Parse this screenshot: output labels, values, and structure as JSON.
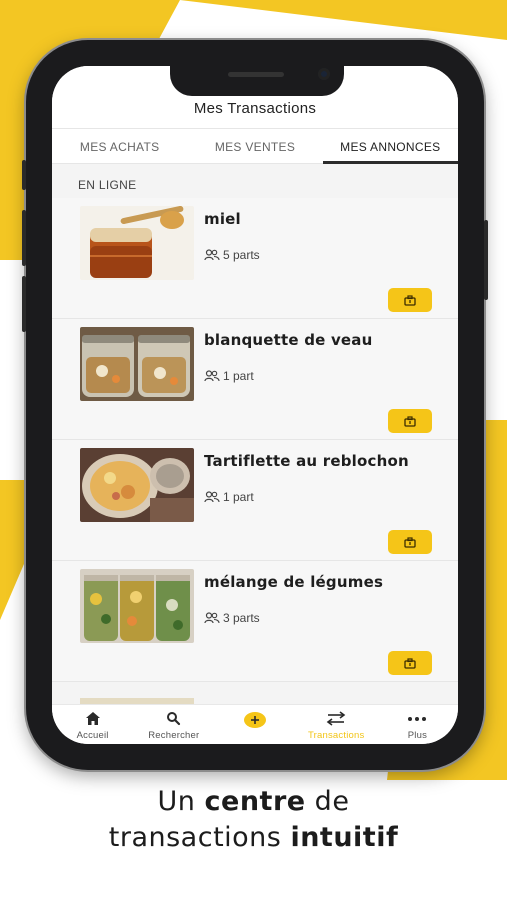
{
  "screen": {
    "title": "Mes Transactions",
    "tabs": [
      {
        "label": "MES ACHATS",
        "active": false
      },
      {
        "label": "MES VENTES",
        "active": false
      },
      {
        "label": "MES ANNONCES",
        "active": true
      }
    ],
    "section_label": "EN LIGNE",
    "items": [
      {
        "title": "miel",
        "parts": "5 parts"
      },
      {
        "title": "blanquette de veau",
        "parts": "1 part"
      },
      {
        "title": "Tartiflette au reblochon",
        "parts": "1 part"
      },
      {
        "title": "mélange de légumes",
        "parts": "3 parts"
      }
    ]
  },
  "bottom_nav": [
    {
      "label": "Accueil",
      "icon": "home-icon",
      "active": false
    },
    {
      "label": "Rechercher",
      "icon": "search-icon",
      "active": false
    },
    {
      "label": "",
      "icon": "add-icon",
      "active": false
    },
    {
      "label": "Transactions",
      "icon": "transfer-icon",
      "active": true
    },
    {
      "label": "Plus",
      "icon": "more-icon",
      "active": false
    }
  ],
  "caption": {
    "line1_a": "Un ",
    "line1_b": "centre",
    "line1_c": " de",
    "line2_a": "transactions ",
    "line2_b": "intuitif"
  },
  "colors": {
    "accent": "#f5c518",
    "background_yellow": "#f3c623",
    "phone_frame": "#1b1b1d"
  }
}
